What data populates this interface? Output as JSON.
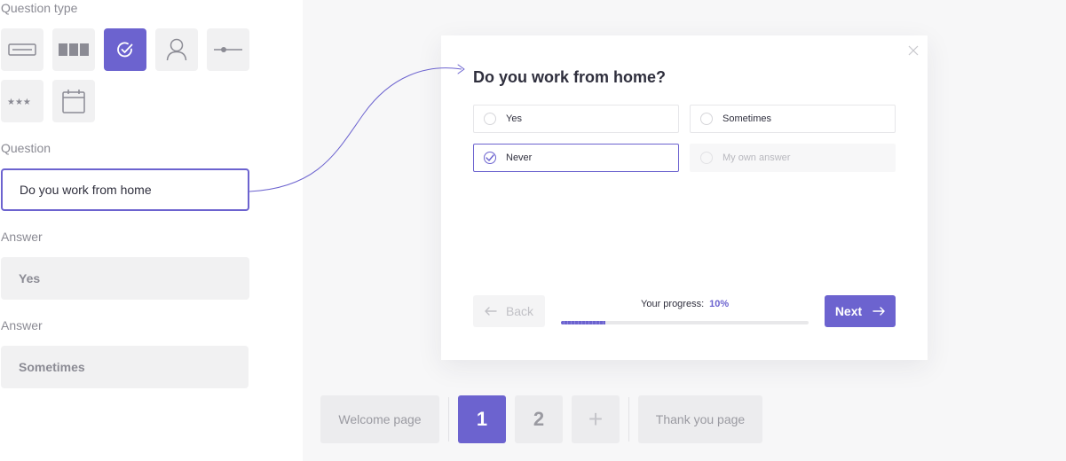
{
  "editor": {
    "question_type_label": "Question type",
    "question_type_icons": [
      "short-text-icon",
      "multi-column-icon",
      "checkmark-icon",
      "user-icon",
      "slider-icon",
      "rating-stars-icon",
      "calendar-icon"
    ],
    "active_question_type": "checkmark-icon",
    "question_label": "Question",
    "question_value": "Do you work from home",
    "answers": [
      {
        "label": "Answer",
        "value": "Yes"
      },
      {
        "label": "Answer",
        "value": "Sometimes"
      }
    ]
  },
  "modal": {
    "title": "Do you work from home?",
    "options": [
      {
        "text": "Yes",
        "state": "default"
      },
      {
        "text": "Sometimes",
        "state": "default"
      },
      {
        "text": "Never",
        "state": "selected"
      },
      {
        "text": "My own answer",
        "state": "disabled"
      }
    ],
    "back_label": "Back",
    "progress_label": "Your progress:",
    "progress_text": "10%",
    "progress_fraction": 0.18,
    "next_label": "Next"
  },
  "pages": {
    "welcome_label": "Welcome page",
    "numbered": [
      "1",
      "2"
    ],
    "active_page": "1",
    "add_label": "+",
    "thank_you_label": "Thank you page"
  },
  "colors": {
    "accent": "#6c63cf",
    "panel_bg": "#f1f1f2",
    "preview_bg": "#f7f7f8"
  }
}
